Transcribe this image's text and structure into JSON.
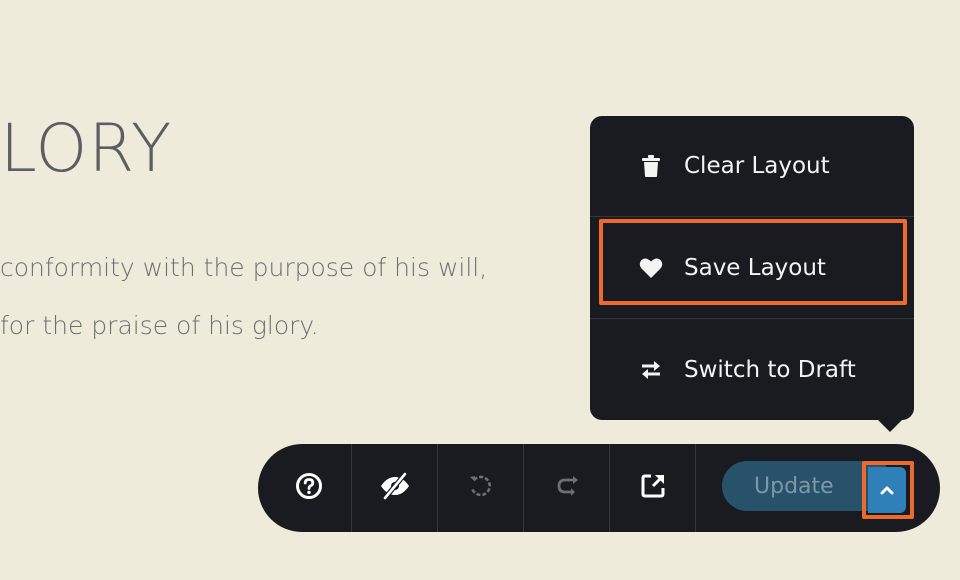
{
  "page": {
    "heading_fragment": "LORY",
    "paragraph_lines": [
      "conformity with the purpose of his will,",
      "for the praise of his glory."
    ]
  },
  "dropdown_menu": {
    "items": [
      {
        "label": "Clear Layout",
        "icon": "trash-icon"
      },
      {
        "label": "Save Layout",
        "icon": "heart-icon",
        "highlighted": true
      },
      {
        "label": "Switch to Draft",
        "icon": "swap-arrows-icon"
      }
    ]
  },
  "toolbar": {
    "tools": [
      {
        "name": "help",
        "icon": "question-circle-icon"
      },
      {
        "name": "toggle-visibility",
        "icon": "eye-slash-icon"
      },
      {
        "name": "undo",
        "icon": "undo-icon",
        "disabled": true
      },
      {
        "name": "redo",
        "icon": "redo-icon",
        "disabled": true
      },
      {
        "name": "open-external",
        "icon": "external-link-icon"
      }
    ],
    "update_label": "Update",
    "caret_icon": "chevron-up-icon",
    "caret_highlighted": true
  },
  "colors": {
    "background": "#efebda",
    "dark_panel": "#191b20",
    "accent_blue": "#2f7fb8",
    "highlight_orange": "#ec6a2c"
  }
}
